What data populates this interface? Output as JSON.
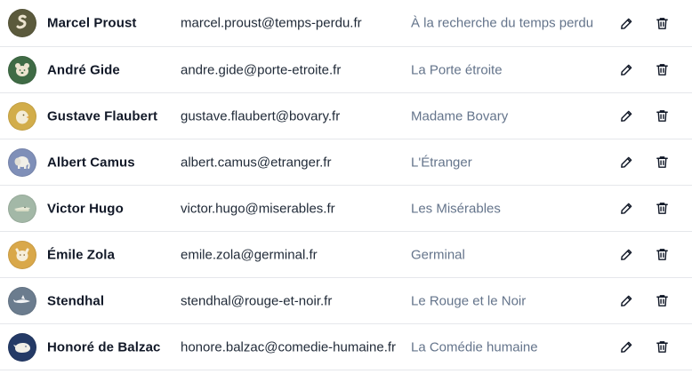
{
  "rows": [
    {
      "name": "Marcel Proust",
      "email": "marcel.proust@temps-perdu.fr",
      "work": "À la recherche du temps perdu",
      "avatar_icon": "snake-icon",
      "avatar_color": "#5b5a3c"
    },
    {
      "name": "André Gide",
      "email": "andre.gide@porte-etroite.fr",
      "work": "La Porte étroite",
      "avatar_icon": "bear-icon",
      "avatar_color": "#3f6b45"
    },
    {
      "name": "Gustave Flaubert",
      "email": "gustave.flaubert@bovary.fr",
      "work": "Madame Bovary",
      "avatar_icon": "chick-icon",
      "avatar_color": "#d2ad4a"
    },
    {
      "name": "Albert Camus",
      "email": "albert.camus@etranger.fr",
      "work": "L'Étranger",
      "avatar_icon": "elephant-icon",
      "avatar_color": "#7f8fb8"
    },
    {
      "name": "Victor Hugo",
      "email": "victor.hugo@miserables.fr",
      "work": "Les Misérables",
      "avatar_icon": "crocodile-icon",
      "avatar_color": "#a3b8a7"
    },
    {
      "name": "Émile Zola",
      "email": "emile.zola@germinal.fr",
      "work": "Germinal",
      "avatar_icon": "cat-icon",
      "avatar_color": "#d9a84a"
    },
    {
      "name": "Stendhal",
      "email": "stendhal@rouge-et-noir.fr",
      "work": "Le Rouge et le Noir",
      "avatar_icon": "shark-icon",
      "avatar_color": "#6b7c8e"
    },
    {
      "name": "Honoré de Balzac",
      "email": "honore.balzac@comedie-humaine.fr",
      "work": "La Comédie humaine",
      "avatar_icon": "whale-icon",
      "avatar_color": "#243a66"
    }
  ],
  "colors": {
    "name_text": "#111827",
    "email_text": "#1f2937",
    "work_text": "#64748b",
    "divider": "#e5e7eb"
  }
}
